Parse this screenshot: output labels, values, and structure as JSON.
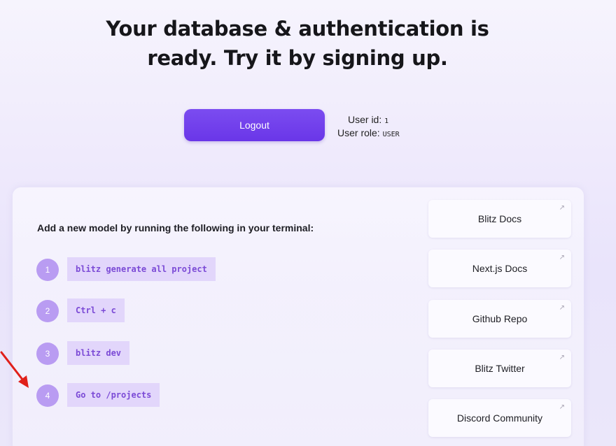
{
  "hero": {
    "line1": "Your database & authentication is",
    "line2": "ready. Try it by signing up."
  },
  "auth": {
    "logout_label": "Logout",
    "user_id_label": "User id:",
    "user_id_value": "1",
    "user_role_label": "User role:",
    "user_role_value": "USER"
  },
  "instructions": {
    "heading": "Add a new model by running the following in your terminal:",
    "steps": [
      {
        "number": "1",
        "code": "blitz generate all project"
      },
      {
        "number": "2",
        "code": "Ctrl + c"
      },
      {
        "number": "3",
        "code": "blitz dev"
      },
      {
        "number": "4",
        "code": "Go to /projects"
      }
    ]
  },
  "links": [
    {
      "label": "Blitz Docs",
      "icon": "external-link-icon"
    },
    {
      "label": "Next.js Docs",
      "icon": "external-link-icon"
    },
    {
      "label": "Github Repo",
      "icon": "external-link-icon"
    },
    {
      "label": "Blitz Twitter",
      "icon": "external-link-icon"
    },
    {
      "label": "Discord Community",
      "icon": "external-link-icon"
    }
  ],
  "colors": {
    "accent": "#6a36e8",
    "step_badge": "#b99cf2",
    "code_bg": "#e2d6fb",
    "code_text": "#7b4ad6",
    "annotation_arrow": "#e0201a"
  }
}
